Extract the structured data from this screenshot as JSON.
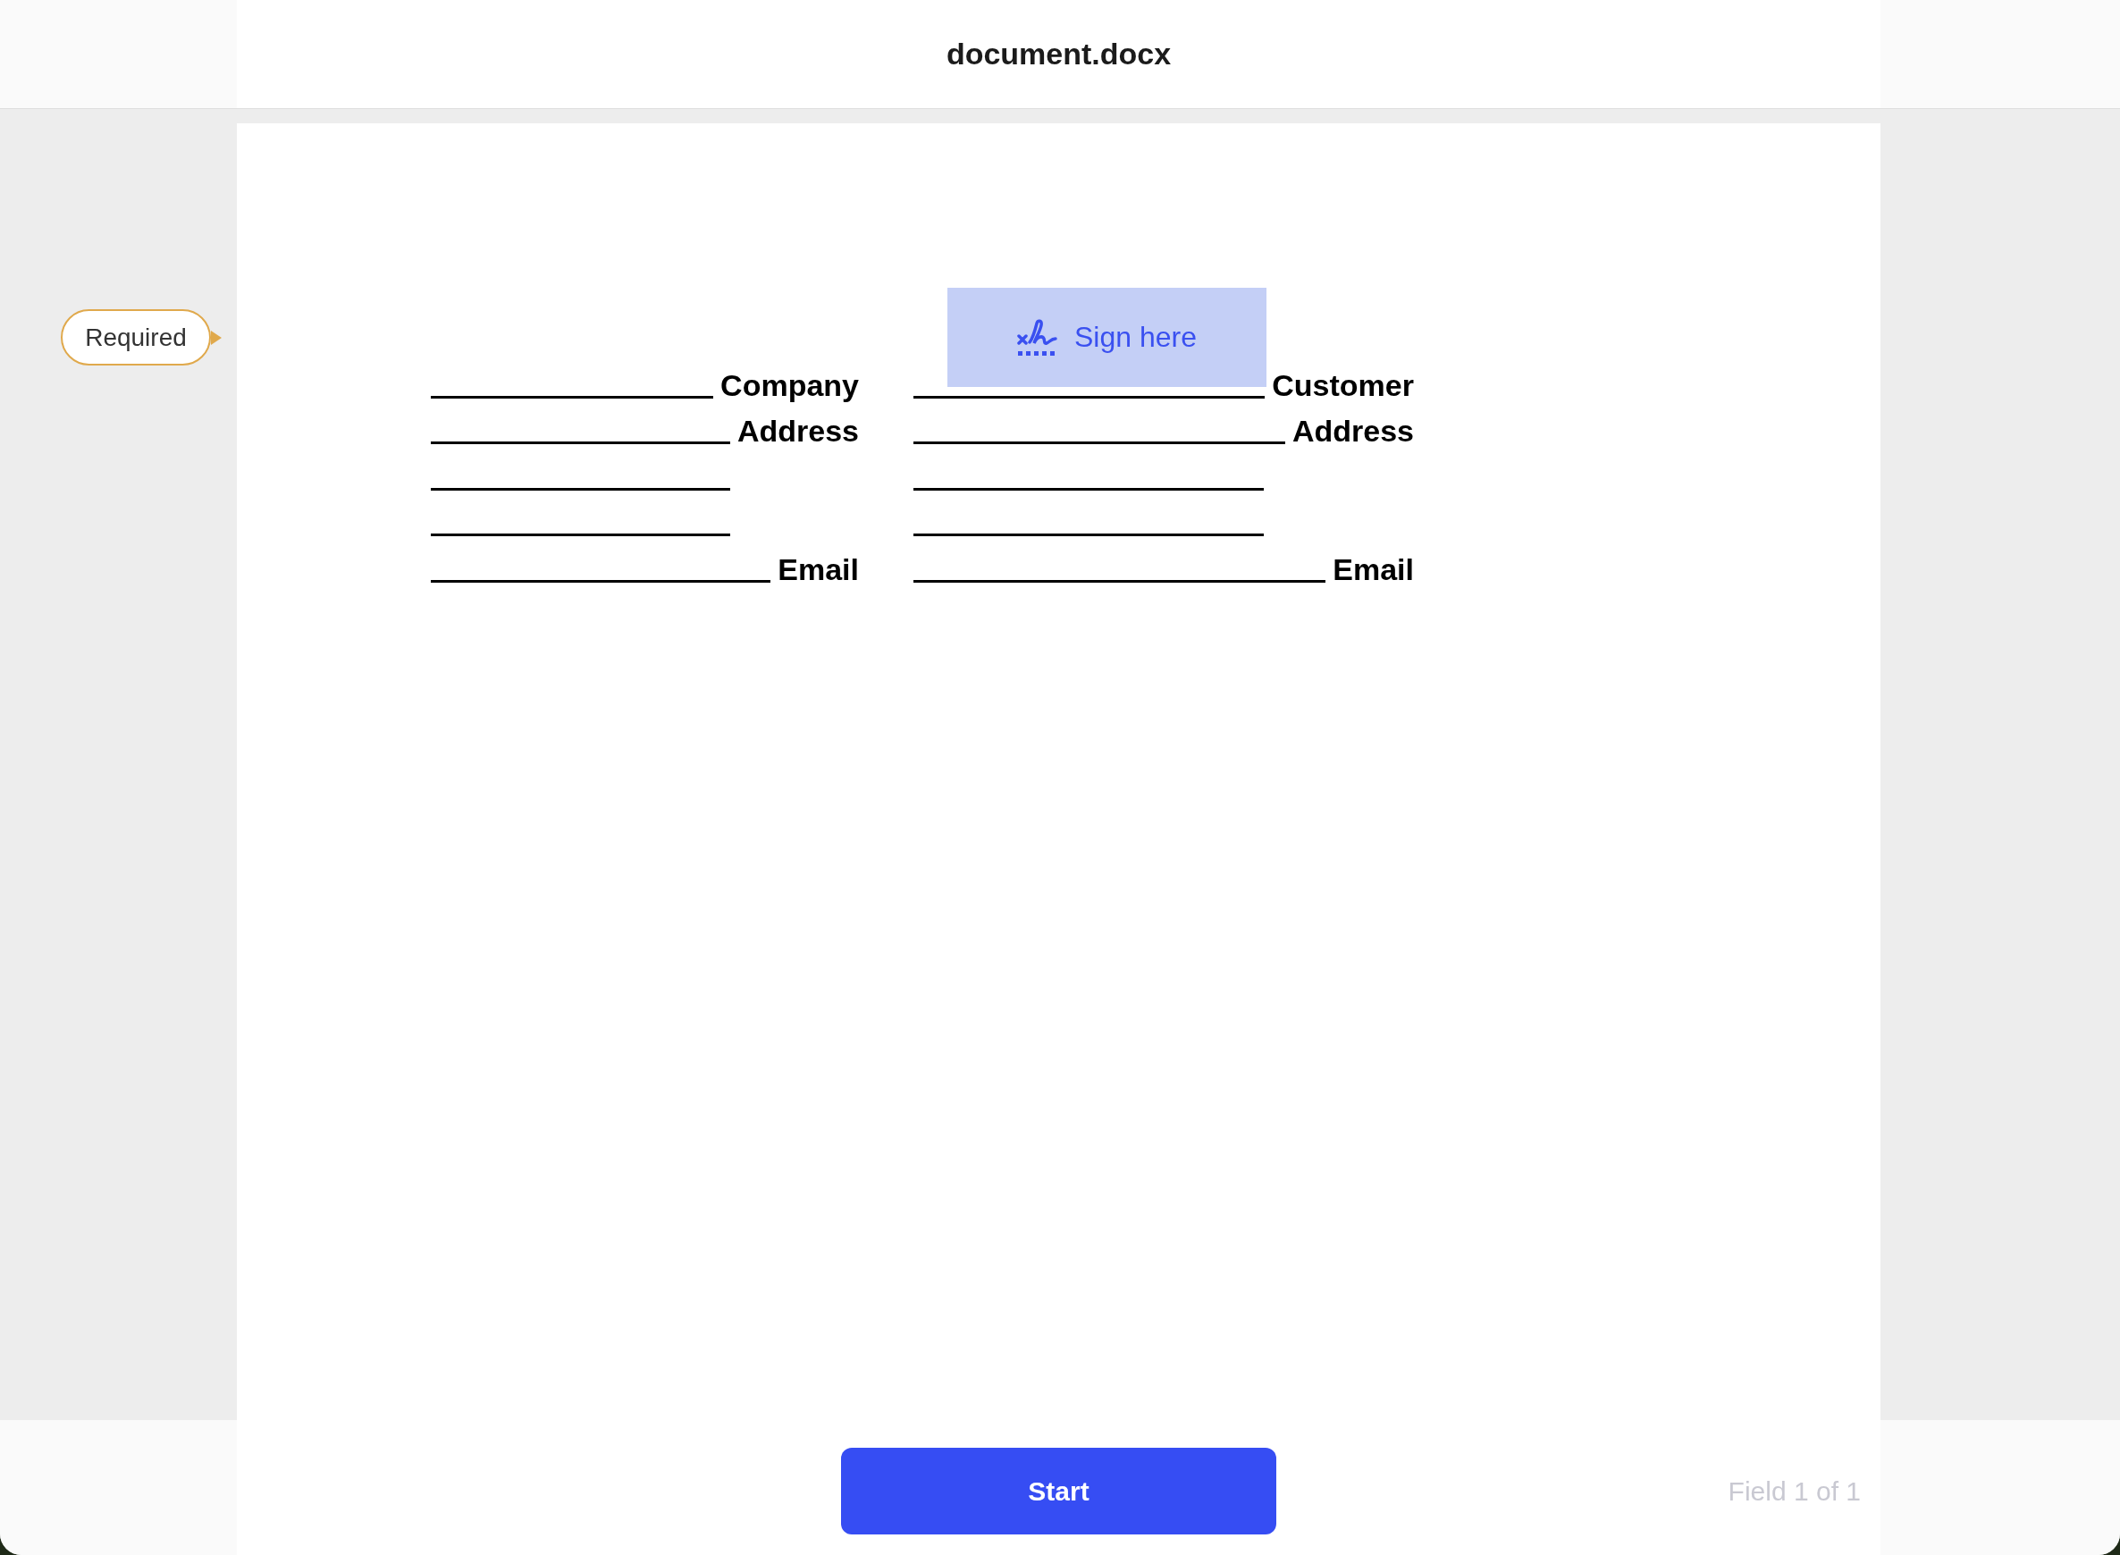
{
  "header": {
    "title": "document.docx"
  },
  "document": {
    "columns": [
      {
        "rows": [
          {
            "kind": "labeled",
            "label": "Company"
          },
          {
            "kind": "labeled",
            "label": "Address"
          },
          {
            "kind": "blank"
          },
          {
            "kind": "blank"
          },
          {
            "kind": "labeled",
            "label": "Email"
          }
        ]
      },
      {
        "rows": [
          {
            "kind": "labeled",
            "label": "Customer"
          },
          {
            "kind": "labeled",
            "label": "Address"
          },
          {
            "kind": "blank"
          },
          {
            "kind": "blank"
          },
          {
            "kind": "labeled",
            "label": "Email"
          }
        ]
      }
    ],
    "signature_field": {
      "label": "Sign here",
      "badge": "Required"
    }
  },
  "footer": {
    "start_button": "Start",
    "field_counter": "Field 1 of 1"
  }
}
